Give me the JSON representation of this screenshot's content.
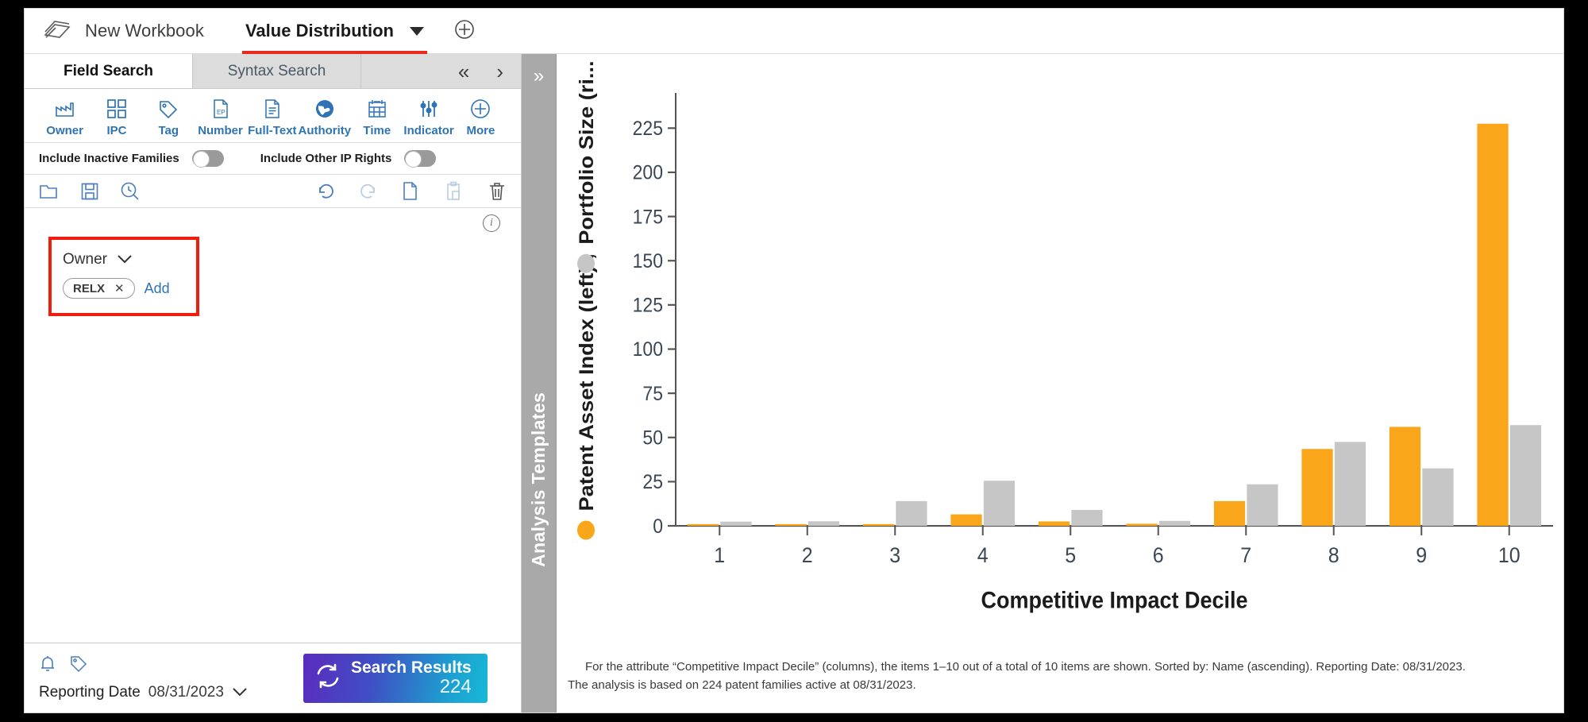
{
  "window": {
    "workbook_title": "New Workbook",
    "active_tab_title": "Value Distribution",
    "book_icon": "books-icon",
    "caret_icon": "chevron-down-icon",
    "add_tab_icon": "plus-circle-icon"
  },
  "left_panel": {
    "tabs": [
      {
        "label": "Field Search",
        "active": true
      },
      {
        "label": "Syntax Search",
        "active": false
      }
    ],
    "collapse_icon": "chevrons-left-icon",
    "expand_icon": "chevron-right-icon",
    "field_icons": [
      {
        "label": "Owner",
        "icon": "factory-icon"
      },
      {
        "label": "IPC",
        "icon": "grid-squares-icon"
      },
      {
        "label": "Tag",
        "icon": "tag-icon"
      },
      {
        "label": "Number",
        "icon": "document-ep-icon"
      },
      {
        "label": "Full-Text",
        "icon": "document-lines-icon"
      },
      {
        "label": "Authority",
        "icon": "globe-icon"
      },
      {
        "label": "Time",
        "icon": "calendar-icon"
      },
      {
        "label": "Indicator",
        "icon": "sliders-icon"
      },
      {
        "label": "More",
        "icon": "plus-circle-icon"
      }
    ],
    "toggles": [
      {
        "label": "Include Inactive Families",
        "on": false
      },
      {
        "label": "Include Other IP Rights",
        "on": false
      }
    ],
    "actions_left": [
      {
        "icon": "folder-open-icon",
        "enabled": true
      },
      {
        "icon": "save-floppy-icon",
        "enabled": true
      },
      {
        "icon": "search-history-icon",
        "enabled": true
      }
    ],
    "actions_right": [
      {
        "icon": "undo-icon",
        "enabled": true
      },
      {
        "icon": "redo-icon",
        "enabled": false
      },
      {
        "icon": "copy-icon",
        "enabled": true
      },
      {
        "icon": "paste-icon",
        "enabled": false
      },
      {
        "icon": "trash-icon",
        "enabled": true
      }
    ],
    "info_icon": "info-circle-icon",
    "filter": {
      "field_label": "Owner",
      "dropdown_icon": "chevron-down-icon",
      "chip_label": "RELX",
      "chip_remove_icon": "close-x-icon",
      "add_label": "Add",
      "highlight_color": "#f01d0f"
    },
    "footer": {
      "bell_icon": "bell-icon",
      "tag_icon": "tag-icon",
      "reporting_label": "Reporting Date",
      "reporting_date": "08/31/2023",
      "date_dropdown_icon": "chevron-down-icon",
      "search_button_label": "Search Results",
      "search_button_count": "224",
      "search_button_icon": "refresh-icon"
    }
  },
  "templates_panel": {
    "title": "Analysis Templates",
    "expand_icon": "chevrons-right-icon"
  },
  "chart_data": {
    "type": "bar",
    "title": "",
    "xlabel": "Competitive Impact Decile",
    "ylabel": "Patent Asset Index (left) ,  Portfolio Size (ri...",
    "ylabel_part_left": "Patent Asset Index (left) ,",
    "ylabel_part_right": "Portfolio Size (ri...",
    "categories": [
      "1",
      "2",
      "3",
      "4",
      "5",
      "6",
      "7",
      "8",
      "9",
      "10"
    ],
    "series": [
      {
        "name": "Patent Asset Index (left)",
        "color": "#f9a61a",
        "values": [
          0.4,
          0.3,
          1.0,
          6.5,
          2.5,
          1.2,
          14.0,
          43.5,
          56.0,
          227.5
        ]
      },
      {
        "name": "Portfolio Size (right)",
        "color": "#c6c6c6",
        "values": [
          2.4,
          2.6,
          14.0,
          25.5,
          9.0,
          2.8,
          23.5,
          47.5,
          32.5,
          57.0
        ]
      }
    ],
    "yticks": [
      0,
      25,
      50,
      75,
      100,
      125,
      150,
      175,
      200,
      225
    ],
    "ylim": [
      0,
      240
    ],
    "grid": false,
    "legend": "y-axis-inline",
    "legend_markers": [
      {
        "shape": "circle",
        "color": "#f9a61a",
        "series": "Patent Asset Index (left)"
      },
      {
        "shape": "circle",
        "color": "#c6c6c6",
        "series": "Portfolio Size (right)"
      }
    ]
  },
  "chart_captions": {
    "line1": "For the attribute “Competitive Impact Decile” (columns), the items 1–10 out of a total of 10 items are shown. Sorted by: Name (ascending). Reporting Date: 08/31/2023.",
    "line2": "The analysis is based on 224 patent families active at 08/31/2023."
  }
}
